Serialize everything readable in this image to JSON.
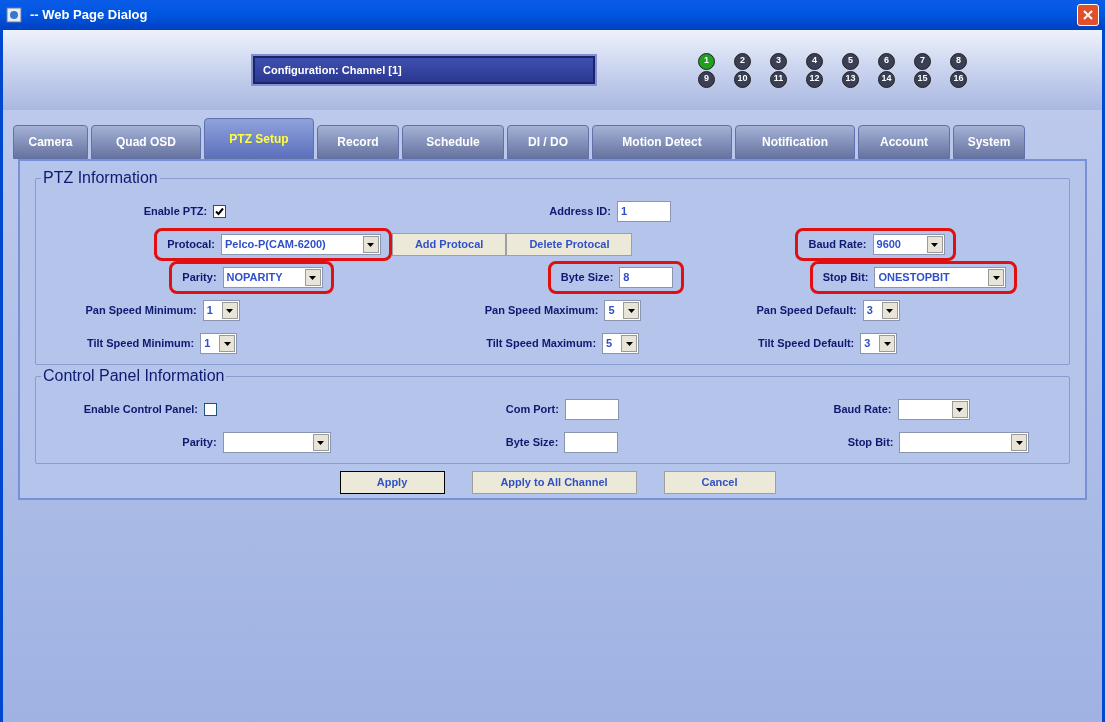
{
  "window": {
    "title": "-- Web Page Dialog"
  },
  "header": {
    "configuration": "Configuration: Channel [1]",
    "channels": [
      {
        "label": "1",
        "selected": true
      },
      {
        "label": "2",
        "selected": false
      },
      {
        "label": "3",
        "selected": false
      },
      {
        "label": "4",
        "selected": false
      },
      {
        "label": "5",
        "selected": false
      },
      {
        "label": "6",
        "selected": false
      },
      {
        "label": "7",
        "selected": false
      },
      {
        "label": "8",
        "selected": false
      },
      {
        "label": "9",
        "selected": false
      },
      {
        "label": "10",
        "selected": false
      },
      {
        "label": "11",
        "selected": false
      },
      {
        "label": "12",
        "selected": false
      },
      {
        "label": "13",
        "selected": false
      },
      {
        "label": "14",
        "selected": false
      },
      {
        "label": "15",
        "selected": false
      },
      {
        "label": "16",
        "selected": false
      }
    ]
  },
  "tabs": [
    {
      "label": "Camera",
      "selected": false
    },
    {
      "label": "Quad OSD",
      "selected": false
    },
    {
      "label": "PTZ Setup",
      "selected": true
    },
    {
      "label": "Record",
      "selected": false
    },
    {
      "label": "Schedule",
      "selected": false
    },
    {
      "label": "DI / DO",
      "selected": false
    },
    {
      "label": "Motion Detect",
      "selected": false
    },
    {
      "label": "Notification",
      "selected": false
    },
    {
      "label": "Account",
      "selected": false
    },
    {
      "label": "System",
      "selected": false
    }
  ],
  "sections": [
    {
      "title": "PTZ Information",
      "rows": [
        [
          {
            "label": "Enable PTZ:",
            "kind": "checkbox",
            "checked": true,
            "highlighted": false
          },
          {
            "label": "Address ID:",
            "kind": "text",
            "value": "1",
            "highlighted": false
          }
        ],
        [
          {
            "label": "Protocal:",
            "kind": "select",
            "value": "Pelco-P(CAM-6200)",
            "highlighted": true,
            "buttons": [
              "Add Protocal",
              "Delete Protocal"
            ]
          },
          null,
          {
            "label": "Baud Rate:",
            "kind": "select",
            "value": "9600",
            "highlighted": true
          }
        ],
        [
          {
            "label": "Parity:",
            "kind": "select",
            "value": "NOPARITY",
            "highlighted": true
          },
          {
            "label": "Byte Size:",
            "kind": "text",
            "value": "8",
            "highlighted": true
          },
          {
            "label": "Stop Bit:",
            "kind": "select",
            "value": "ONESTOPBIT",
            "highlighted": true
          }
        ],
        [
          {
            "label": "Pan Speed Minimum:",
            "kind": "select",
            "value": "1",
            "highlighted": false
          },
          {
            "label": "Pan Speed Maximum:",
            "kind": "select",
            "value": "5",
            "highlighted": false
          },
          {
            "label": "Pan Speed Default:",
            "kind": "select",
            "value": "3",
            "highlighted": false
          }
        ],
        [
          {
            "label": "Tilt Speed Minimum:",
            "kind": "select",
            "value": "1",
            "highlighted": false
          },
          {
            "label": "Tilt Speed Maximum:",
            "kind": "select",
            "value": "5",
            "highlighted": false
          },
          {
            "label": "Tilt Speed Default:",
            "kind": "select",
            "value": "3",
            "highlighted": false
          }
        ]
      ]
    },
    {
      "title": "Control Panel Information",
      "rows": [
        [
          {
            "label": "Enable Control Panel:",
            "kind": "checkbox",
            "checked": false,
            "highlighted": false
          },
          {
            "label": "Com Port:",
            "kind": "text",
            "highlighted": false
          },
          {
            "label": "Baud Rate:",
            "kind": "select",
            "highlighted": false
          }
        ],
        [
          {
            "label": "Parity:",
            "kind": "select",
            "highlighted": false
          },
          {
            "label": "Byte Size:",
            "kind": "text",
            "highlighted": false
          },
          {
            "label": "Stop Bit:",
            "kind": "select",
            "highlighted": false
          }
        ]
      ]
    }
  ],
  "actions": [
    "Apply",
    "Apply to All Channel",
    "Cancel"
  ]
}
